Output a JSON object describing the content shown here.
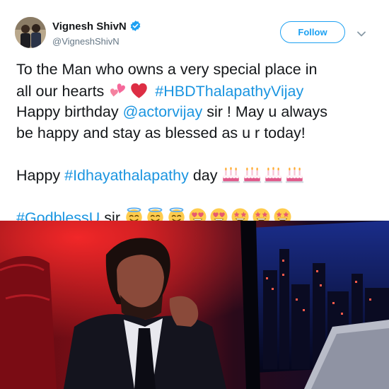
{
  "user": {
    "display_name": "Vignesh ShivN",
    "handle": "@VigneshShivN",
    "verified": true
  },
  "actions": {
    "follow_label": "Follow",
    "menu_icon": "chevron-down-icon"
  },
  "tweet": {
    "line1": "To the Man who owns a very special place in",
    "line2_text": "all our hearts",
    "line2_emojis": [
      "two-hearts-emoji",
      "red-heart-emoji"
    ],
    "line2_hashtag": "#HBDThalapathyVijay",
    "line3_prefix": "Happy birthday ",
    "line3_mention": "@actorvijay",
    "line3_suffix": " sir ! May u always",
    "line4": "be happy and stay as blessed as u r today!",
    "line5_prefix": "Happy ",
    "line5_hashtag": "#Idhayathalapathy",
    "line5_suffix": " day",
    "line5_emojis": [
      "birthday-cake-emoji",
      "birthday-cake-emoji",
      "birthday-cake-emoji",
      "birthday-cake-emoji"
    ],
    "line6_hashtag": "#GodblessU",
    "line6_suffix": " sir",
    "line6_emojis": [
      "halo-emoji",
      "halo-emoji",
      "halo-emoji",
      "heart-eyes-emoji",
      "heart-eyes-emoji",
      "star-struck-emoji",
      "star-struck-emoji",
      "star-struck-emoji"
    ]
  },
  "colors": {
    "link": "#1b95e0",
    "follow": "#1da1f2",
    "text": "#14171a",
    "secondary": "#657786",
    "photo_red": "#c0141c",
    "photo_blue": "#1a1f6e"
  },
  "photo": {
    "description_icon": "car-interior-photo"
  }
}
